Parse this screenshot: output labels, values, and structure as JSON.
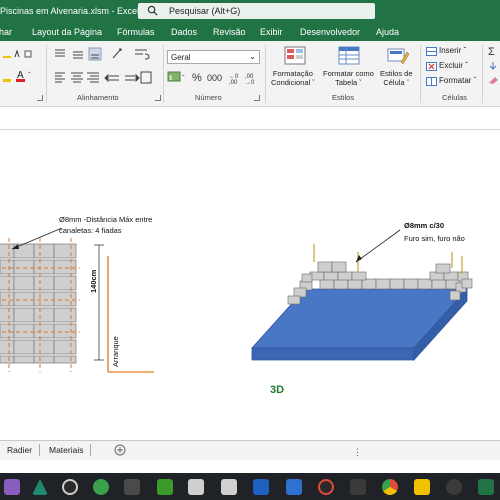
{
  "window": {
    "title": "Piscinas em Alvenaria.xlsm  -  Excel",
    "search_placeholder": "Pesquisar (Alt+G)"
  },
  "tabs": [
    "har",
    "Layout da Página",
    "Fórmulas",
    "Dados",
    "Revisão",
    "Exibir",
    "Desenvolvedor",
    "Ajuda"
  ],
  "ribbon": {
    "alignment_group": "Alinhamento",
    "number_group": "Número",
    "styles_group": "Estilos",
    "cells_group": "Células",
    "number_format": "Geral",
    "conditional_formatting": "Formatação\nCondicional ˇ",
    "format_as_table": "Formatar como\nTabela ˇ",
    "cell_styles": "Estilos de\nCélula ˇ",
    "insert": "Inserir ˇ",
    "delete": "Excluir ˇ",
    "format": "Formatar ˇ"
  },
  "sheet": {
    "note_left_1": "Ø8mm -Distância Máx entre",
    "note_left_2": "canaletas: 4 fiadas",
    "note_right_1": "Ø8mm c/30",
    "note_right_2": "Furo sim, furo não",
    "height_label": "140cm",
    "arranque_label": "Arranque",
    "label_3d": "3D"
  },
  "sheet_tabs": [
    "Radier",
    "Materiais"
  ],
  "colors": {
    "excel_green": "#217346",
    "deck_blue": "#4a76c6",
    "rebar_orange": "#e07a1f",
    "label_green": "#1f7a2e"
  }
}
